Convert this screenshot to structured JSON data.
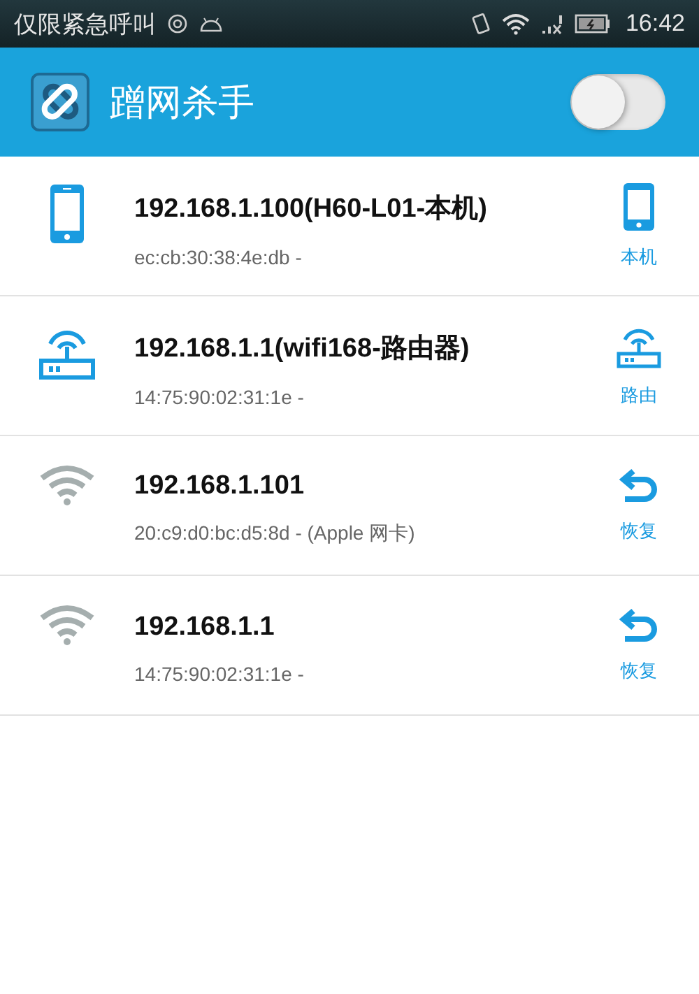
{
  "status_bar": {
    "carrier": "仅限紧急呼叫",
    "time": "16:42"
  },
  "app_bar": {
    "title": "蹭网杀手",
    "switch_on": false
  },
  "devices": [
    {
      "kind": "phone",
      "title": "192.168.1.100(H60-L01-本机)",
      "subtitle": "ec:cb:30:38:4e:db -",
      "action": {
        "kind": "phone",
        "label": "本机"
      }
    },
    {
      "kind": "router",
      "title": "192.168.1.1(wifi168-路由器)",
      "subtitle": "14:75:90:02:31:1e -",
      "action": {
        "kind": "router",
        "label": "路由"
      }
    },
    {
      "kind": "wifi",
      "title": "192.168.1.101",
      "subtitle": "20:c9:d0:bc:d5:8d - (Apple 网卡)",
      "action": {
        "kind": "restore",
        "label": "恢复"
      }
    },
    {
      "kind": "wifi",
      "title": "192.168.1.1",
      "subtitle": "14:75:90:02:31:1e -",
      "action": {
        "kind": "restore",
        "label": "恢复"
      }
    }
  ]
}
